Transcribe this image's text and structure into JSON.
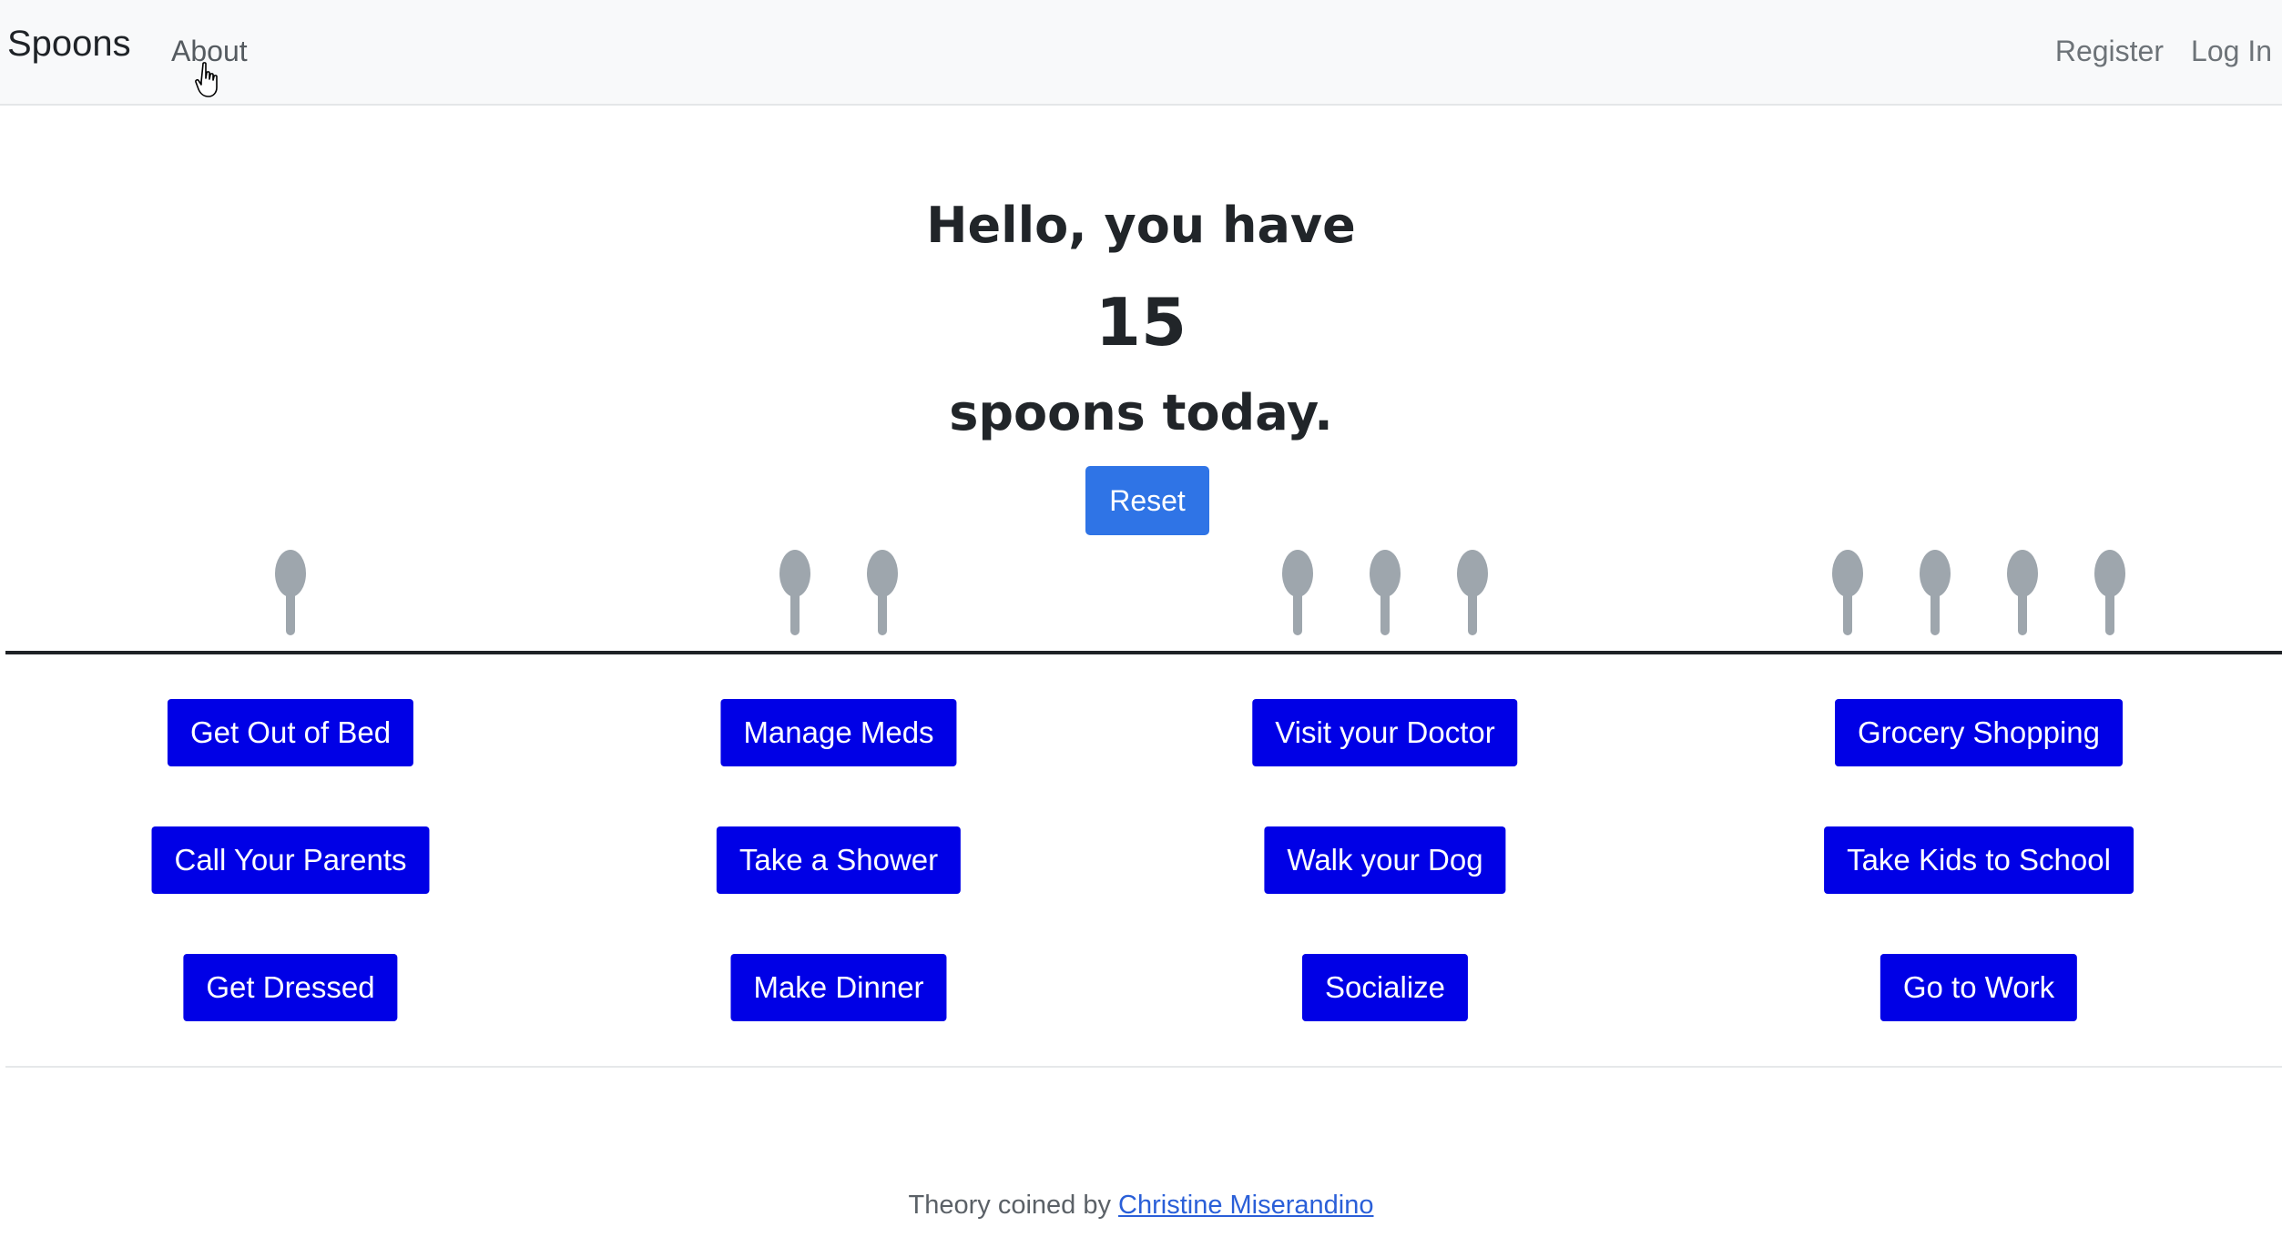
{
  "nav": {
    "brand": "Spoons",
    "about": "About",
    "register": "Register",
    "login": "Log In"
  },
  "greeting": {
    "line1": "Hello, you have",
    "count": "15",
    "line2": "spoons today."
  },
  "reset_label": "Reset",
  "spoon_groups": [
    1,
    2,
    3,
    4
  ],
  "spoon_color": "#9ea6ad",
  "activity_columns": [
    {
      "spoons": 1,
      "activities": [
        "Get Out of Bed",
        "Call Your Parents",
        "Get Dressed"
      ]
    },
    {
      "spoons": 2,
      "activities": [
        "Manage Meds",
        "Take a Shower",
        "Make Dinner"
      ]
    },
    {
      "spoons": 3,
      "activities": [
        "Visit your Doctor",
        "Walk your Dog",
        "Socialize"
      ]
    },
    {
      "spoons": 4,
      "activities": [
        "Grocery Shopping",
        "Take Kids to School",
        "Go to Work"
      ]
    }
  ],
  "colors": {
    "navbar_bg": "#f8f9fa",
    "reset_button": "#2f74e6",
    "activity_button": "#0000e6",
    "link": "#2a5fd8"
  },
  "footer": {
    "text": "Theory coined by",
    "link_text": "Christine Miserandino"
  }
}
